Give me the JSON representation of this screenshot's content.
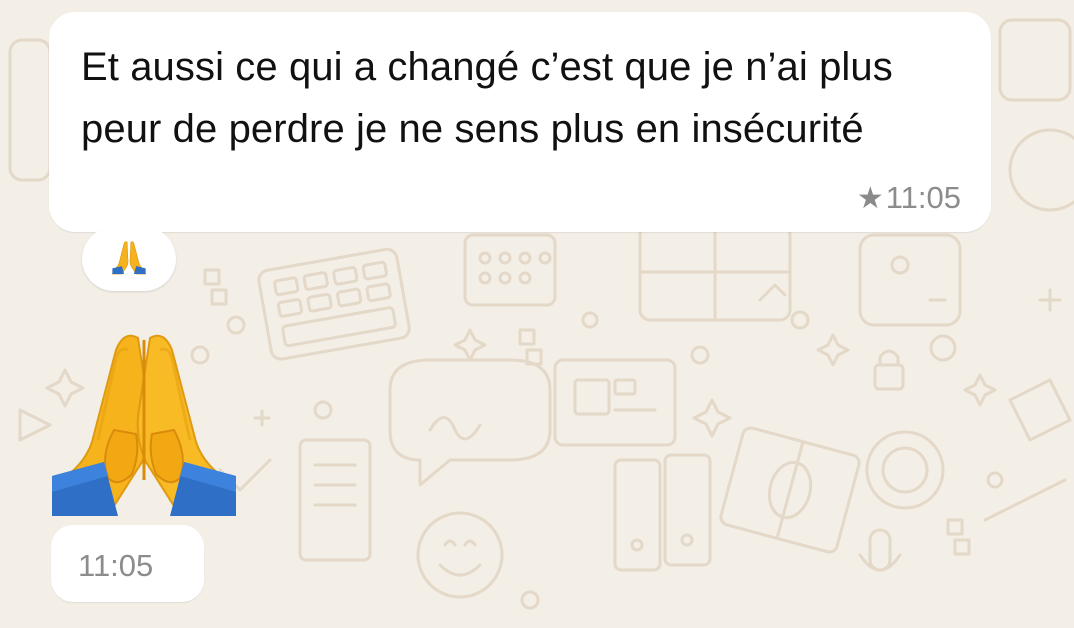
{
  "chat": {
    "wallpaper": "whatsapp-doodle-pattern",
    "colors": {
      "background": "#f3eee6",
      "bubble": "#ffffff",
      "meta_text": "#8c8c8c",
      "emoji_skin": "#f5b21d",
      "emoji_sleeve": "#2f6fc6"
    },
    "messages": [
      {
        "text": "Et aussi ce qui a changé c’est que je n’ai plus peur de perdre je ne sens plus en insécurité",
        "starred": true,
        "star_glyph": "★",
        "time": "11:05",
        "reaction": {
          "emoji": "🙏",
          "icon": "folded-hands-icon"
        }
      },
      {
        "emoji": "🙏",
        "icon": "folded-hands-icon",
        "time": "11:05"
      }
    ]
  }
}
